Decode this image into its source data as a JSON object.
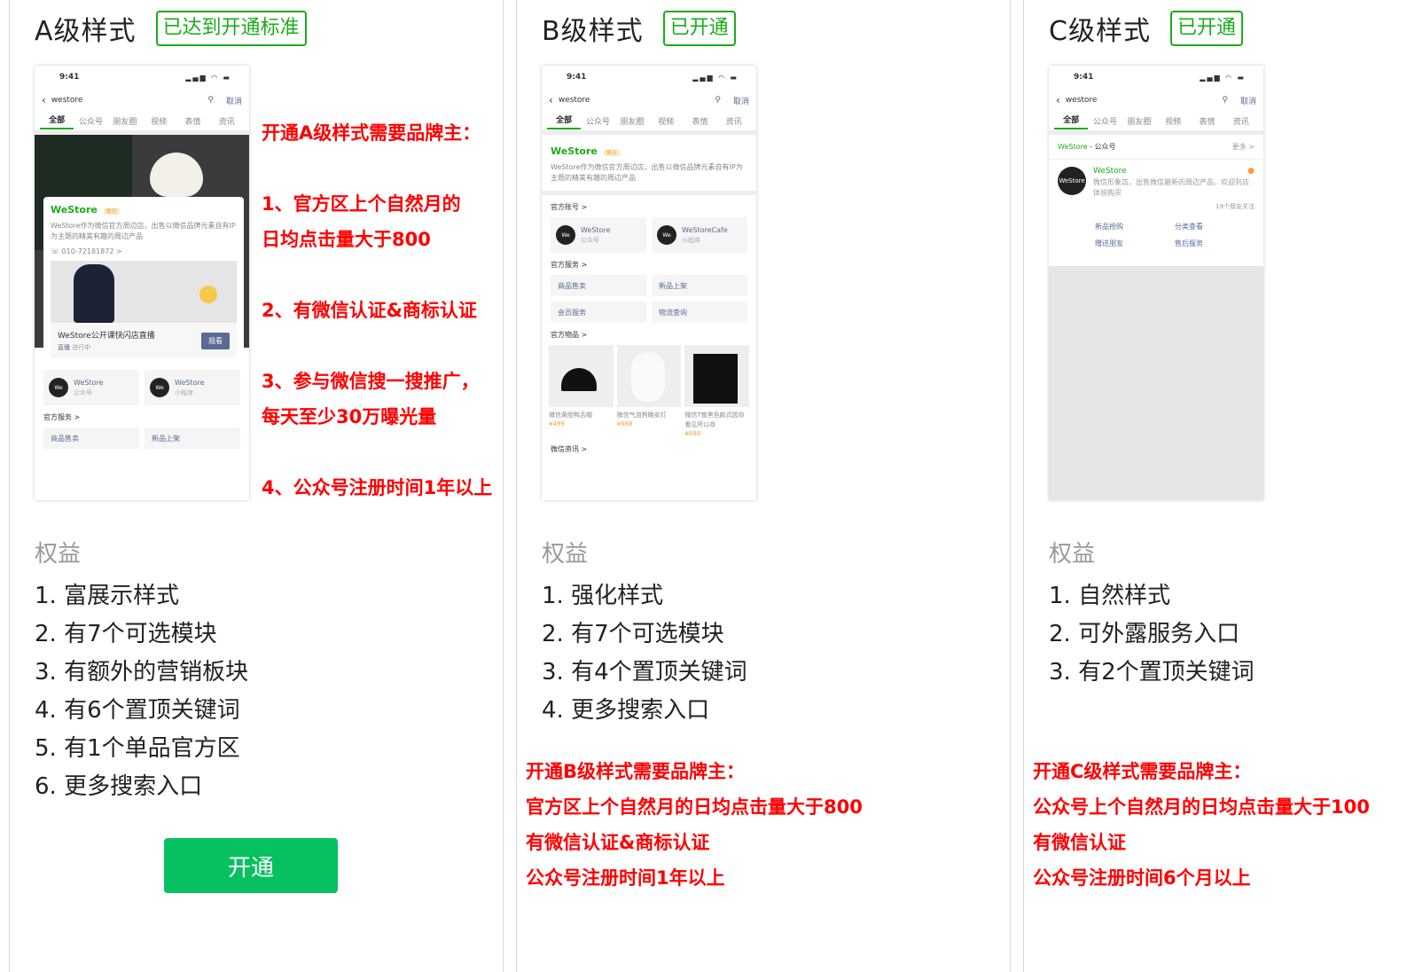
{
  "levels": {
    "a": {
      "title": "A级样式",
      "badge": "已达到开通标准",
      "requirements": [
        "开通A级样式需要品牌主：",
        "1、官方区上个自然月的",
        "日均点击量大于800",
        "2、有微信认证&商标认证",
        "3、参与微信搜一搜推广，",
        "每天至少30万曝光量",
        "4、公众号注册时间1年以上"
      ],
      "perks_title": "权益",
      "perks": [
        "1. 富展示样式",
        "2. 有7个可选模块",
        "3. 有额外的营销板块",
        "4. 有6个置顶关键词",
        "5. 有1个单品官方区",
        "6. 更多搜索入口"
      ],
      "open_button": "开通"
    },
    "b": {
      "title": "B级样式",
      "badge": "已开通",
      "perks_title": "权益",
      "perks": [
        "1. 强化样式",
        "2. 有7个可选模块",
        "3. 有4个置顶关键词",
        "4. 更多搜索入口"
      ],
      "requirements": [
        "开通B级样式需要品牌主：",
        "官方区上个自然月的日均点击量大于800",
        "有微信认证&商标认证",
        "公众号注册时间1年以上"
      ]
    },
    "c": {
      "title": "C级样式",
      "badge": "已开通",
      "perks_title": "权益",
      "perks": [
        "1. 自然样式",
        "2. 可外露服务入口",
        "3. 有2个置顶关键词"
      ],
      "requirements": [
        "开通C级样式需要品牌主：",
        "公众号上个自然月的日均点击量大于100",
        "有微信认证",
        "公众号注册时间6个月以上"
      ]
    }
  },
  "phone": {
    "time": "9:41",
    "status_icons": "▂▄▆ ◠ ▬",
    "query": "westore",
    "cancel": "取消",
    "tabs": [
      "全部",
      "公众号",
      "朋友圈",
      "视频",
      "表情",
      "资讯"
    ],
    "brand": "WeStore",
    "brand_tag": "官方",
    "desc_a": "WeStore作为微信官方周边店，出售以微信品牌元素自有IP为主题的精美有趣的周边产品",
    "desc_b": "WeStore作为微信官方周边店，出售以微信品牌元素自有IP为主题的精美有趣的周边产品",
    "phone_number": "010-72181872 >",
    "live_title": "WeStore公开课快闪店直播",
    "live_tag": "直播",
    "live_status": "进行中",
    "watch": "观看",
    "sec_accounts": "官方账号 >",
    "sec_services": "官方服务 >",
    "sec_goods": "官方物品 >",
    "sec_more": "微信资讯 >",
    "acc1_name": "WeStore",
    "acc1_type": "公众号",
    "acc2_name_a": "WeStore",
    "acc2_name_b": "WeStoreCafe",
    "acc2_type": "小程序",
    "logo_text": "WeStore",
    "services": [
      "商品售卖",
      "新品上架",
      "会员服务",
      "物流查询"
    ],
    "goods": [
      {
        "cap": "微信黄脸鸭舌帽",
        "price": "¥499"
      },
      {
        "cap": "微信气泡狗晚安灯",
        "price": "¥688"
      },
      {
        "cap": "微信T恤黑色款式因你看见所以存",
        "price": "¥688"
      }
    ],
    "c_head_brand": "WeStore",
    "c_head_type": " - 公众号",
    "c_more": "更多 >",
    "c_desc": "微信形象店。出售微信最新的周边产品，欢迎到店体验购买",
    "c_follow": "19个朋友关注",
    "c_links": [
      "新品抢购",
      "分类查看",
      "赠送朋友",
      "售后服务"
    ]
  }
}
